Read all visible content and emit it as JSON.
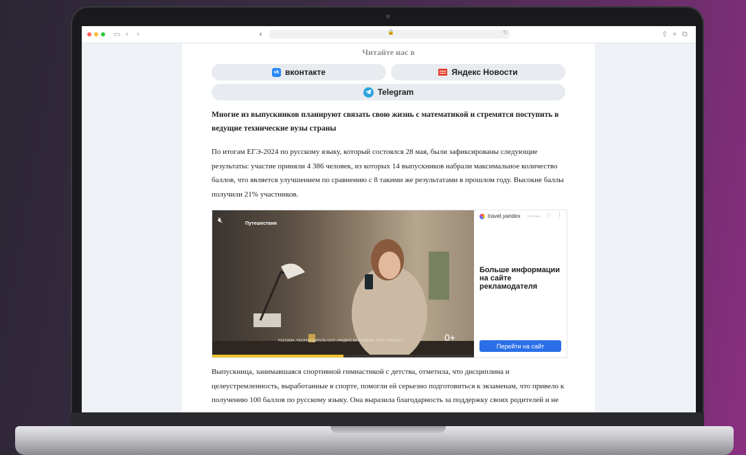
{
  "browser": {
    "address_lock": "🔒",
    "reload": "↻"
  },
  "page": {
    "read_us_title": "Читайте нас в",
    "social": [
      {
        "label": "вконтакте",
        "icon": "vk-icon",
        "color": "#2787f5"
      },
      {
        "label": "Яндекс Новости",
        "icon": "yandex-news-icon",
        "color": "#e6402f"
      },
      {
        "label": "Telegram",
        "icon": "telegram-icon",
        "color": "#2aa3de"
      }
    ],
    "lead": "Многие из выпускников планируют связать свою жизнь с математикой и стремятся поступить в ведущие технические вузы страны",
    "paragraph1": "По итогам ЕГЭ-2024 по русскому языку, который состоялся 28 мая, были зафиксированы следующие результаты: участие приняли 4 386 человек, из которых 14 выпускников набрали максимальное количество баллов, что является улучшением по сравнению с 8 такими же результатами в прошлом году. Высокие баллы получили 21% участников.",
    "paragraph2": "Выпускница, занимавшаяся спортивной гимнастикой с детства, отметила, что дисциплина и целеустремленность, выработанные в спорте, помогли ей серьезно подготовиться к экзаменам, что привело к получению 100 баллов по русскому языку. Она выразила благодарность за поддержку своих родителей и не рассчитывала только на свою природную грамотность."
  },
  "ad": {
    "video_brand": "Путешествия",
    "age_rating": "0+",
    "disclaimer": "РЕКЛАМА. РЕКЛАМОДАТЕЛЬ ООО «ЯНДЕКС.ВЕРТИКАЛИ» ИНН 7704340327",
    "advertiser": "travel.yandex",
    "ad_label": "РЕКЛАМА",
    "headline": "Больше информации на сайте рекламодателя",
    "cta": "Перейти на сайт",
    "progress": 0.5,
    "accent": "#2a6fe8"
  }
}
